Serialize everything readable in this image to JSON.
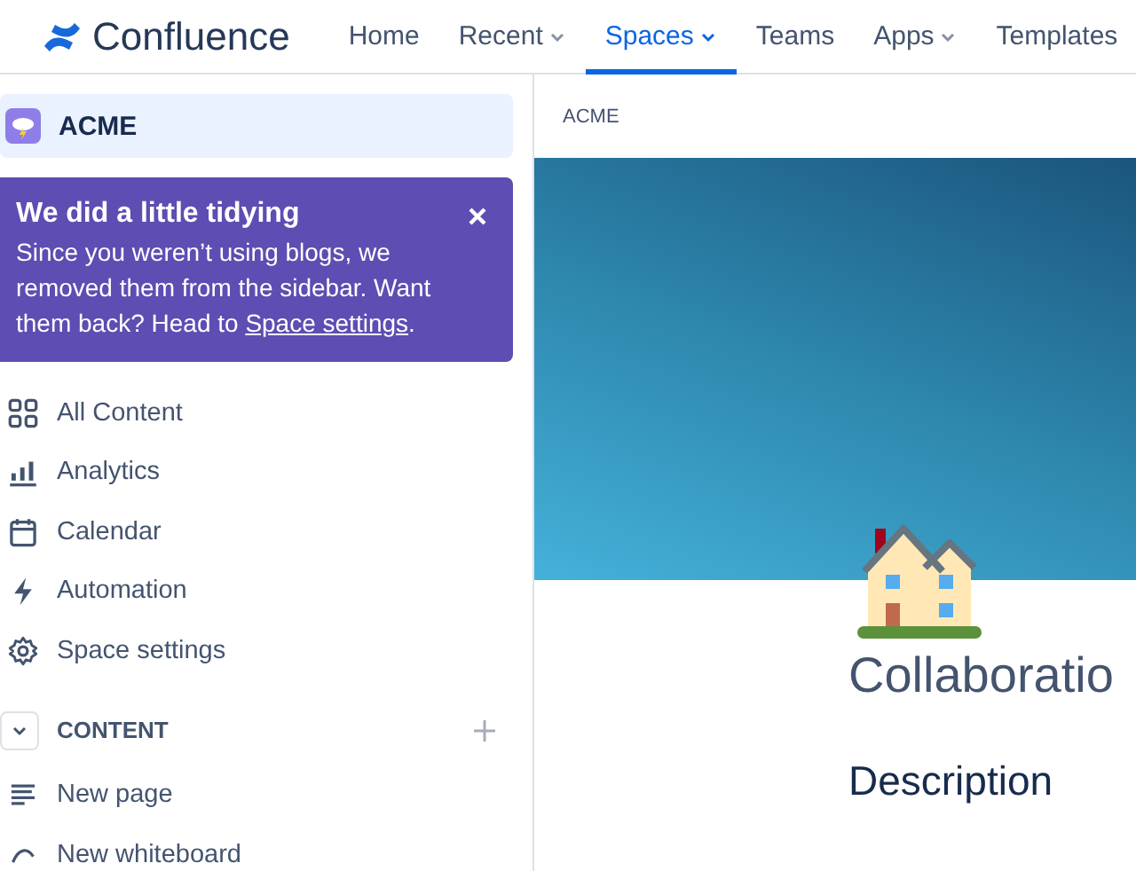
{
  "top_nav": {
    "logo": "Confluence",
    "items": [
      {
        "label": "Home",
        "dropdown": false,
        "selected": false
      },
      {
        "label": "Recent",
        "dropdown": true,
        "selected": false
      },
      {
        "label": "Spaces",
        "dropdown": true,
        "selected": true
      },
      {
        "label": "Teams",
        "dropdown": false,
        "selected": false
      },
      {
        "label": "Apps",
        "dropdown": true,
        "selected": false
      },
      {
        "label": "Templates",
        "dropdown": false,
        "selected": false
      }
    ]
  },
  "sidebar": {
    "space": {
      "name": "ACME",
      "selected": true
    },
    "notice": {
      "title": "We did a little tidying",
      "text": "Since you weren’t using blogs, we removed them from the sidebar. Want them back? Head to ",
      "link": "Space settings",
      "end": "."
    },
    "items": [
      {
        "kind": "grid",
        "label": "All Content"
      },
      {
        "kind": "chart",
        "label": "Analytics"
      },
      {
        "kind": "calendar",
        "label": "Calendar"
      },
      {
        "kind": "bolt",
        "label": "Automation"
      },
      {
        "kind": "gear",
        "label": "Space settings"
      }
    ],
    "section": {
      "title": "CONTENT",
      "expanded": true
    },
    "content_items": [
      {
        "kind": "page",
        "label": "New page"
      },
      {
        "kind": "whiteboard",
        "label": "New whiteboard"
      }
    ]
  },
  "main": {
    "breadcrumb": "ACME",
    "title": "Collaboratio",
    "heading": "Description"
  }
}
